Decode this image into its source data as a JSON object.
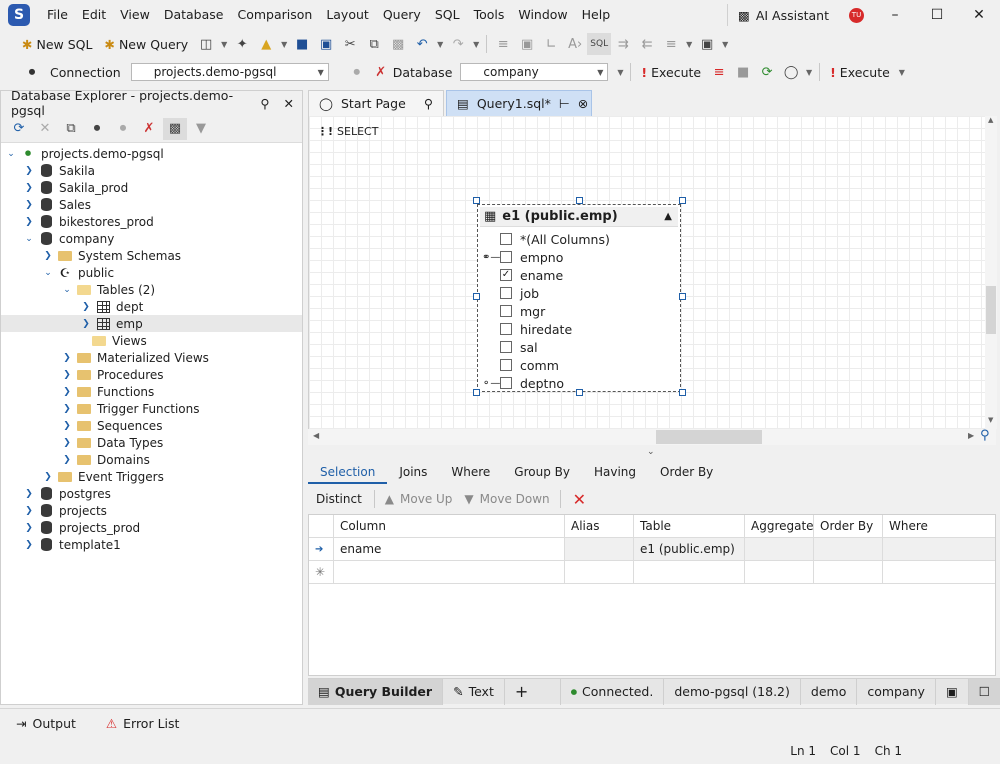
{
  "menu": {
    "items": [
      "File",
      "Edit",
      "View",
      "Database",
      "Comparison",
      "Layout",
      "Query",
      "SQL",
      "Tools",
      "Window",
      "Help"
    ],
    "ai_assistant": "AI Assistant",
    "avatar": "TU",
    "app_logo": "S"
  },
  "toolbar1": {
    "new_sql": "New SQL",
    "new_query": "New Query"
  },
  "toolbar2": {
    "connection_label": "Connection",
    "connection_value": "projects.demo-pgsql",
    "database_label": "Database",
    "database_value": "company",
    "execute": "Execute",
    "execute2": "Execute"
  },
  "explorer": {
    "title": "Database Explorer - projects.demo-pgsql",
    "root": "projects.demo-pgsql",
    "nodes": [
      {
        "label": "Sakila"
      },
      {
        "label": "Sakila_prod"
      },
      {
        "label": "Sales"
      },
      {
        "label": "bikestores_prod"
      },
      {
        "label": "company"
      },
      {
        "label": "System Schemas"
      },
      {
        "label": "public"
      },
      {
        "label": "Tables (2)"
      },
      {
        "label": "dept"
      },
      {
        "label": "emp"
      },
      {
        "label": "Views"
      },
      {
        "label": "Materialized Views"
      },
      {
        "label": "Procedures"
      },
      {
        "label": "Functions"
      },
      {
        "label": "Trigger Functions"
      },
      {
        "label": "Sequences"
      },
      {
        "label": "Data Types"
      },
      {
        "label": "Domains"
      },
      {
        "label": "Event Triggers"
      },
      {
        "label": "postgres"
      },
      {
        "label": "projects"
      },
      {
        "label": "projects_prod"
      },
      {
        "label": "template1"
      }
    ]
  },
  "tabs": {
    "start_page": "Start Page",
    "query": "Query1.sql*"
  },
  "diagram": {
    "select_label": "SELECT",
    "entity_title": "e1 (public.emp)",
    "columns": [
      {
        "name": "*(All Columns)",
        "checked": false,
        "key": ""
      },
      {
        "name": "empno",
        "checked": false,
        "key": "primary-key"
      },
      {
        "name": "ename",
        "checked": true,
        "key": ""
      },
      {
        "name": "job",
        "checked": false,
        "key": ""
      },
      {
        "name": "mgr",
        "checked": false,
        "key": ""
      },
      {
        "name": "hiredate",
        "checked": false,
        "key": ""
      },
      {
        "name": "sal",
        "checked": false,
        "key": ""
      },
      {
        "name": "comm",
        "checked": false,
        "key": ""
      },
      {
        "name": "deptno",
        "checked": false,
        "key": "foreign-key"
      }
    ]
  },
  "builder": {
    "tabs": [
      "Selection",
      "Joins",
      "Where",
      "Group By",
      "Having",
      "Order By"
    ],
    "distinct": "Distinct",
    "move_up": "Move Up",
    "move_down": "Move Down",
    "headers": [
      "Column",
      "Alias",
      "Table",
      "Aggregate",
      "Order By",
      "Where"
    ],
    "rows": [
      {
        "column": "ename",
        "alias": "",
        "table": "e1 (public.emp)",
        "aggregate": "",
        "order_by": "",
        "where": ""
      }
    ]
  },
  "status": {
    "query_builder": "Query Builder",
    "text": "Text",
    "connected": "Connected.",
    "server": "demo-pgsql (18.2)",
    "user": "demo",
    "database": "company"
  },
  "bottom": {
    "output": "Output",
    "error_list": "Error List"
  },
  "footer": {
    "ln": "Ln 1",
    "col": "Col 1",
    "ch": "Ch 1"
  },
  "colors": {
    "accent": "#1f5fa8",
    "active_tab": "#cfe0f5",
    "error_red": "#d72a2a",
    "connected_green": "#2e8b2e"
  }
}
